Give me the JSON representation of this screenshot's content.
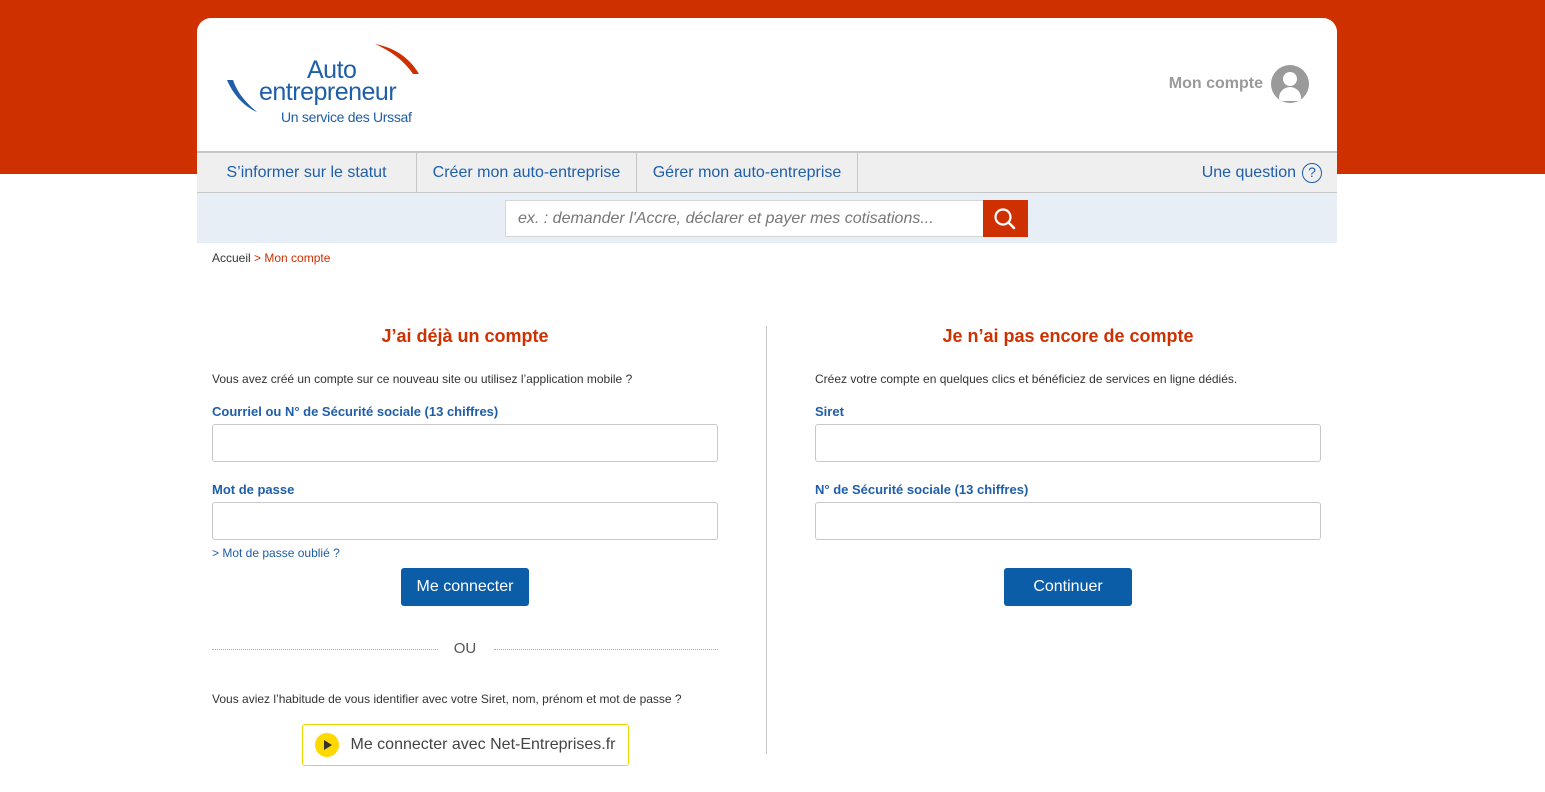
{
  "brand": {
    "logo_line1": "Auto",
    "logo_line2": "entrepreneur",
    "logo_line3": "Un service des Urssaf",
    "color_primary": "#1f5ea8",
    "color_accent": "#cf3000"
  },
  "header": {
    "account_label": "Mon compte",
    "account_icon": "user-icon"
  },
  "nav": {
    "items": [
      {
        "label": "S’informer sur le statut"
      },
      {
        "label": "Créer mon auto-entreprise"
      },
      {
        "label": "Gérer mon auto-entreprise"
      }
    ],
    "question_label": "Une question",
    "question_icon": "?"
  },
  "search": {
    "placeholder": "ex. : demander l'Accre, déclarer et payer mes cotisations...",
    "icon": "search-icon"
  },
  "breadcrumb": {
    "home": "Accueil",
    "separator": " > ",
    "current": "Mon compte"
  },
  "login": {
    "title": "J’ai déjà un compte",
    "intro": "Vous avez créé un compte sur ce nouveau site ou utilisez l’application mobile ?",
    "email_label": "Courriel ou N° de Sécurité sociale (13 chiffres)",
    "email_value": "",
    "password_label": "Mot de passe",
    "password_value": "",
    "forgot_label": "> Mot de passe oublié ?",
    "submit_label": "Me connecter",
    "or_label": "OU",
    "habit_text": "Vous aviez l’habitude de vous identifier avec votre Siret, nom, prénom et mot de passe ?",
    "net_label": "Me connecter avec Net-Entreprises.fr",
    "net_icon": "play-icon"
  },
  "register": {
    "title": "Je n’ai pas encore de compte",
    "intro": "Créez votre compte en quelques clics et bénéficiez de services en ligne dédiés.",
    "siret_label": "Siret",
    "siret_value": "",
    "ssn_label": "N° de Sécurité sociale (13 chiffres)",
    "ssn_value": "",
    "submit_label": "Continuer"
  }
}
